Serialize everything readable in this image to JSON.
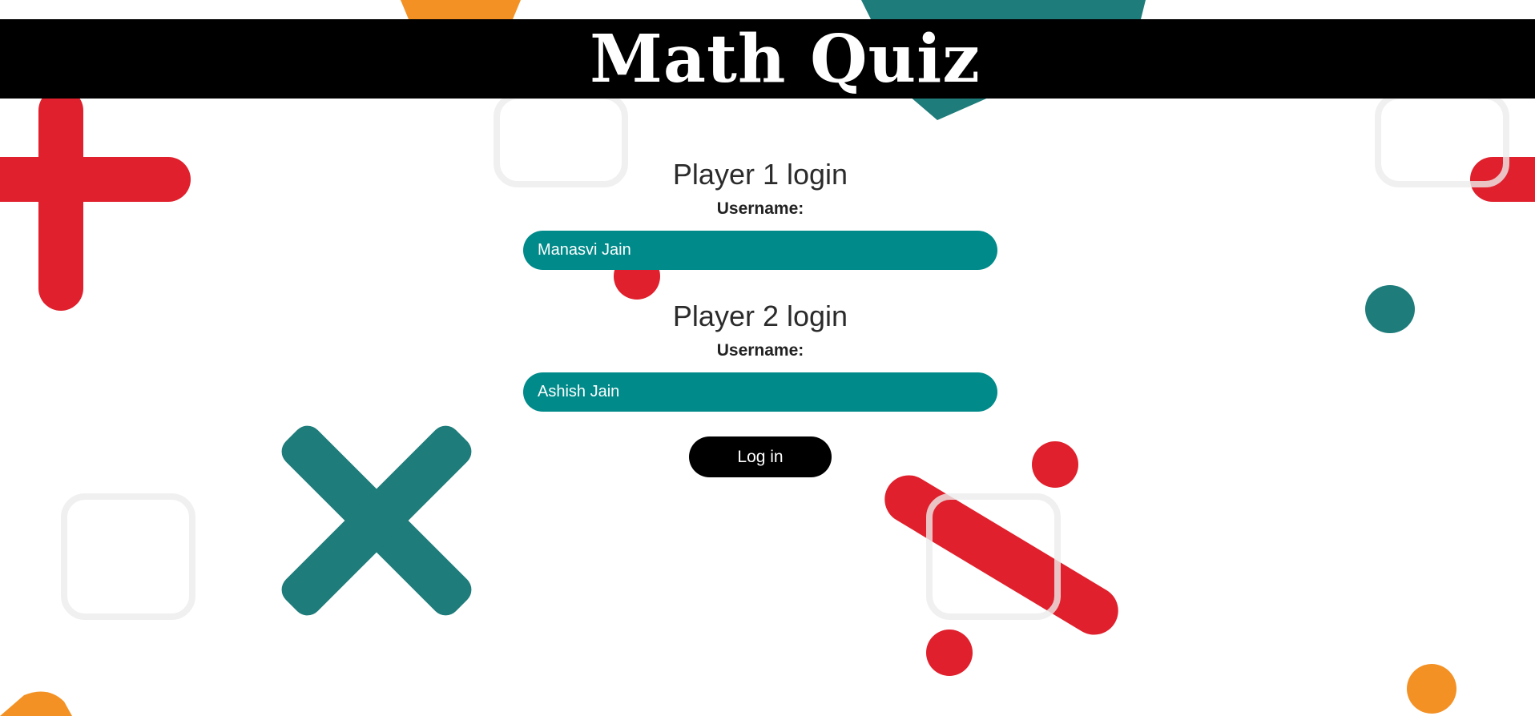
{
  "header": {
    "title": "Math Quiz"
  },
  "players": [
    {
      "heading": "Player 1 login",
      "username_label": "Username:",
      "username_value": "Manasvi Jain"
    },
    {
      "heading": "Player 2 login",
      "username_label": "Username:",
      "username_value": "Ashish Jain"
    }
  ],
  "login_button": {
    "label": "Log in"
  },
  "colors": {
    "header_bg": "#000000",
    "input_bg": "#008a8a",
    "button_bg": "#000000",
    "red_shape": "#e0202c",
    "teal_shape": "#1e7c7a",
    "orange_shape": "#f39124"
  }
}
